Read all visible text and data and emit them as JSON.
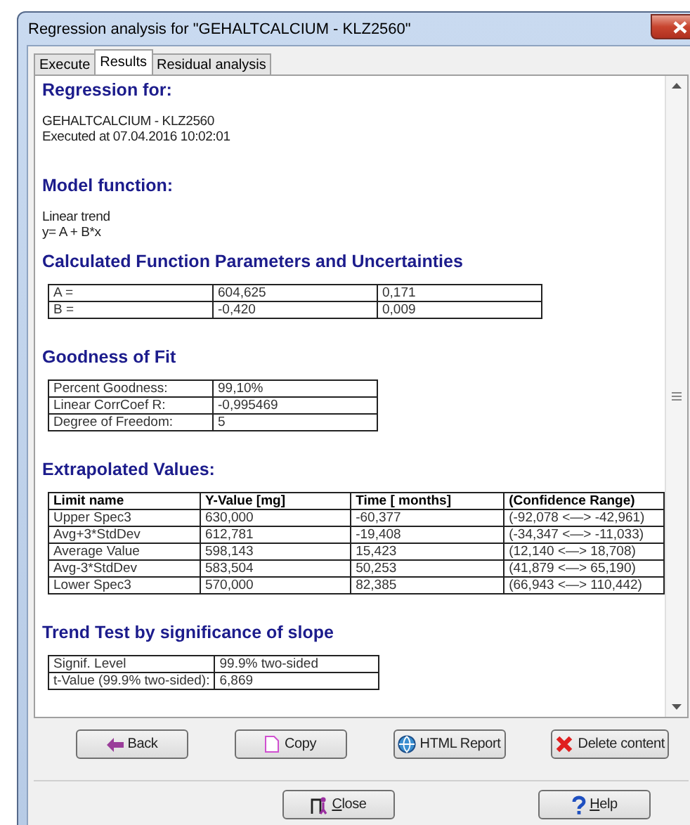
{
  "window": {
    "title": "Regression analysis for \"GEHALTCALCIUM - KLZ2560\""
  },
  "tabs": [
    {
      "label": "Execute",
      "selected": false
    },
    {
      "label": "Results",
      "selected": true
    },
    {
      "label": "Residual analysis",
      "selected": false
    }
  ],
  "report": {
    "regression_heading": "Regression for:",
    "subject": "GEHALTCALCIUM - KLZ2560",
    "executed": "Executed at 07.04.2016 10:02:01",
    "model_heading": "Model function:",
    "model_lines": [
      "Linear trend",
      "y= A + B*x"
    ],
    "params_heading": "Calculated Function Parameters and Uncertainties",
    "params_rows": [
      [
        "A =",
        "604,625",
        "0,171"
      ],
      [
        "B =",
        "-0,420",
        "0,009"
      ]
    ],
    "fit_heading": "Goodness of Fit",
    "fit_rows": [
      [
        "Percent Goodness:",
        "99,10%"
      ],
      [
        "Linear CorrCoef R:",
        "-0,995469"
      ],
      [
        "Degree of Freedom:",
        "5"
      ]
    ],
    "extrap_heading": "Extrapolated Values:",
    "extrap_columns": [
      "Limit name",
      "Y-Value [mg]",
      "Time [ months]",
      "(Confidence Range)"
    ],
    "extrap_rows": [
      [
        "Upper Spec3",
        "630,000",
        "-60,377",
        "(-92,078  <—>  -42,961)"
      ],
      [
        "Avg+3*StdDev",
        "612,781",
        "-19,408",
        "(-34,347  <—>  -11,033)"
      ],
      [
        "Average Value",
        "598,143",
        "15,423",
        "(12,140  <—>  18,708)"
      ],
      [
        "Avg-3*StdDev",
        "583,504",
        "50,253",
        "(41,879  <—>  65,190)"
      ],
      [
        "Lower Spec3",
        "570,000",
        "82,385",
        "(66,943  <—>  110,442)"
      ]
    ],
    "trend_heading": "Trend Test by significance of slope",
    "trend_rows": [
      [
        "Signif. Level",
        "99.9% two-sided"
      ],
      [
        "t-Value (99.9% two-sided):",
        "6,869"
      ]
    ]
  },
  "actions": [
    {
      "label": "Back",
      "kind": "back"
    },
    {
      "label": "Copy",
      "kind": "copy"
    },
    {
      "label": "HTML Report",
      "kind": "report"
    },
    {
      "label": "Delete content",
      "kind": "delete"
    }
  ],
  "footer_buttons": [
    {
      "label": "Close",
      "kind": "close"
    },
    {
      "label": "Help",
      "kind": "help"
    }
  ]
}
